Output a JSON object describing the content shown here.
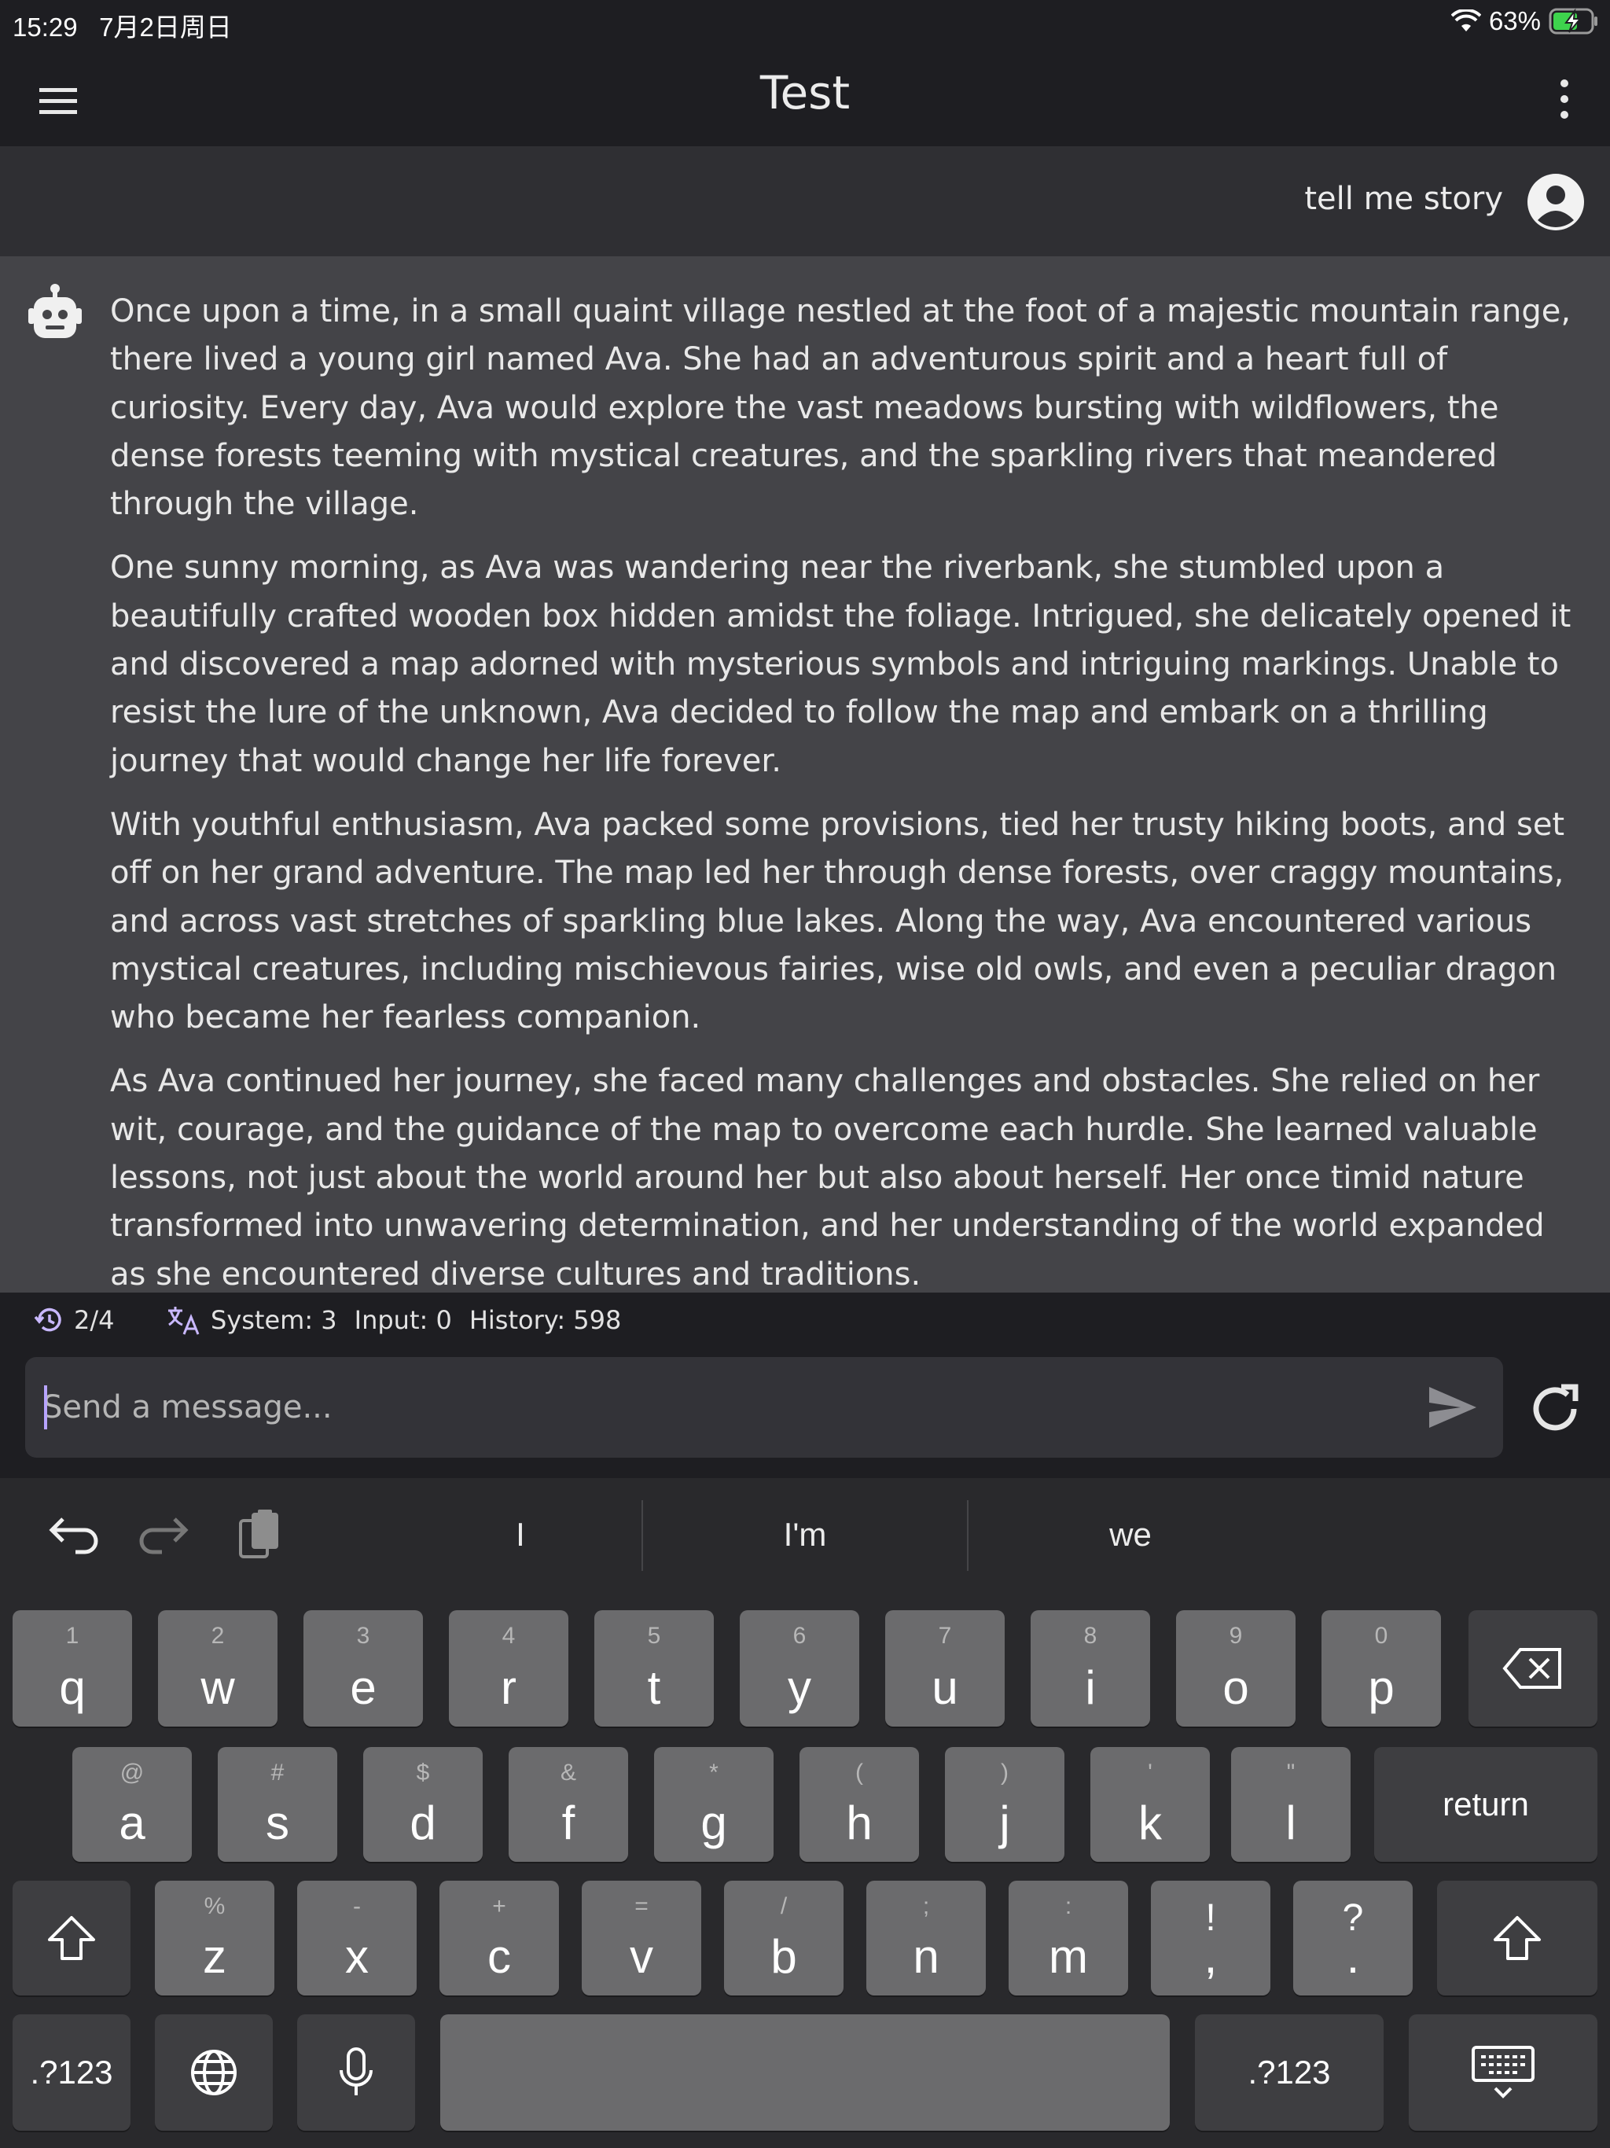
{
  "status_bar": {
    "time": "15:29",
    "date": "7月2日周日",
    "battery": "63%"
  },
  "header": {
    "title": "Test"
  },
  "user_message": {
    "text": "tell me story"
  },
  "assistant_message": {
    "paragraphs": [
      "Once upon a time, in a small quaint village nestled at the foot of a majestic mountain range, there lived a young girl named Ava. She had an adventurous spirit and a heart full of curiosity. Every day, Ava would explore the vast meadows bursting with wildflowers, the dense forests teeming with mystical creatures, and the sparkling rivers that meandered through the village.",
      "One sunny morning, as Ava was wandering near the riverbank, she stumbled upon a beautifully crafted wooden box hidden amidst the foliage. Intrigued, she delicately opened it and discovered a map adorned with mysterious symbols and intriguing markings. Unable to resist the lure of the unknown, Ava decided to follow the map and embark on a thrilling journey that would change her life forever.",
      "With youthful enthusiasm, Ava packed some provisions, tied her trusty hiking boots, and set off on her grand adventure. The map led her through dense forests, over craggy mountains, and across vast stretches of sparkling blue lakes. Along the way, Ava encountered various mystical creatures, including mischievous fairies, wise old owls, and even a peculiar dragon who became her fearless companion.",
      "As Ava continued her journey, she faced many challenges and obstacles. She relied on her wit, courage, and the guidance of the map to overcome each hurdle. She learned valuable lessons, not just about the world around her but also about herself. Her once timid nature transformed into unwavering determination, and her understanding of the world expanded as she encountered diverse cultures and traditions."
    ]
  },
  "stats": {
    "history_count": "2/4",
    "system": "System: 3",
    "input": "Input: 0",
    "history": "History: 598"
  },
  "composer": {
    "placeholder": "Send a message..."
  },
  "keyboard": {
    "suggestions": [
      "I",
      "I'm",
      "we"
    ],
    "row1": [
      {
        "hint": "1",
        "main": "q"
      },
      {
        "hint": "2",
        "main": "w"
      },
      {
        "hint": "3",
        "main": "e"
      },
      {
        "hint": "4",
        "main": "r"
      },
      {
        "hint": "5",
        "main": "t"
      },
      {
        "hint": "6",
        "main": "y"
      },
      {
        "hint": "7",
        "main": "u"
      },
      {
        "hint": "8",
        "main": "i"
      },
      {
        "hint": "9",
        "main": "o"
      },
      {
        "hint": "0",
        "main": "p"
      }
    ],
    "row2": [
      {
        "hint": "@",
        "main": "a"
      },
      {
        "hint": "#",
        "main": "s"
      },
      {
        "hint": "$",
        "main": "d"
      },
      {
        "hint": "&",
        "main": "f"
      },
      {
        "hint": "*",
        "main": "g"
      },
      {
        "hint": "(",
        "main": "h"
      },
      {
        "hint": ")",
        "main": "j"
      },
      {
        "hint": "'",
        "main": "k"
      },
      {
        "hint": "\"",
        "main": "l"
      }
    ],
    "row3": [
      {
        "hint": "%",
        "main": "z"
      },
      {
        "hint": "-",
        "main": "x"
      },
      {
        "hint": "+",
        "main": "c"
      },
      {
        "hint": "=",
        "main": "v"
      },
      {
        "hint": "/",
        "main": "b"
      },
      {
        "hint": ";",
        "main": "n"
      },
      {
        "hint": ":",
        "main": "m"
      },
      {
        "hint": "!",
        "main": ","
      },
      {
        "hint": "?",
        "main": "."
      }
    ],
    "return_label": "return",
    "numbers_label": ".?123"
  }
}
